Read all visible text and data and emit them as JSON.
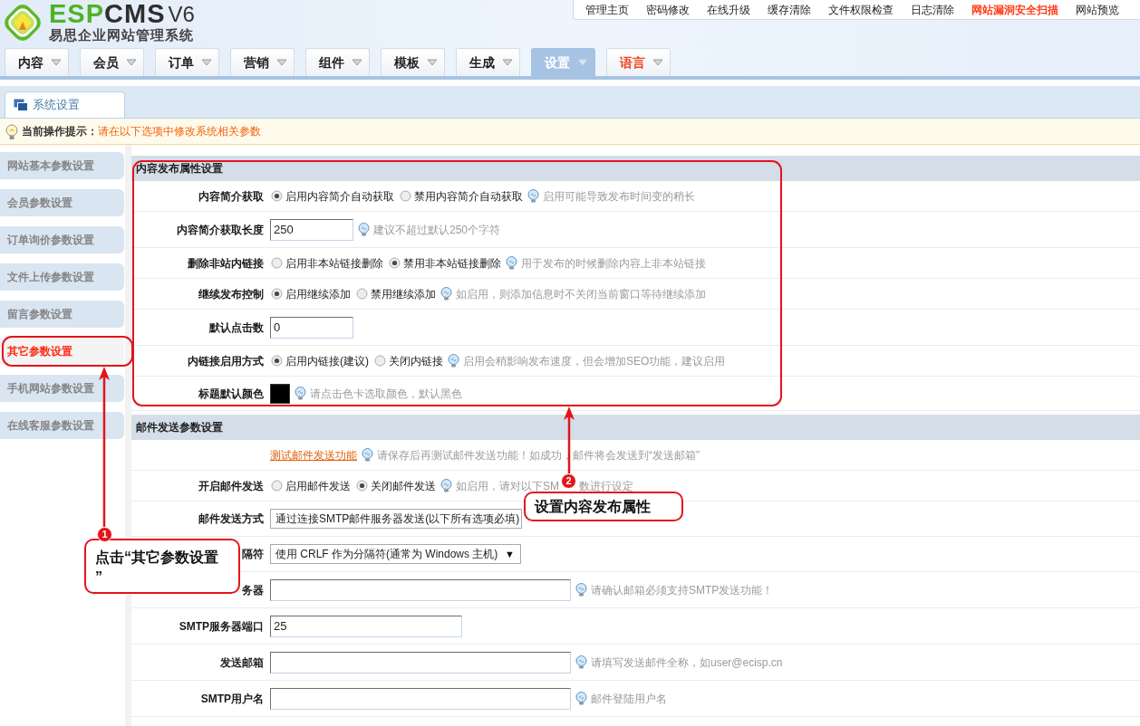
{
  "logo": {
    "wordmark": [
      {
        "text": "ESP",
        "color": "#4fb227"
      },
      {
        "text": "CMS",
        "color": "#2e2e2e"
      }
    ],
    "version": "V6",
    "tagline": "易思企业网站管理系统"
  },
  "top_links": [
    {
      "label": "管理主页",
      "highlight": false
    },
    {
      "label": "密码修改",
      "highlight": false
    },
    {
      "label": "在线升级",
      "highlight": false
    },
    {
      "label": "缓存清除",
      "highlight": false
    },
    {
      "label": "文件权限检查",
      "highlight": false
    },
    {
      "label": "日志清除",
      "highlight": false
    },
    {
      "label": "网站漏洞安全扫描",
      "highlight": true
    },
    {
      "label": "网站预览",
      "highlight": false
    }
  ],
  "main_tabs": [
    {
      "label": "内容",
      "selected": false,
      "highlight": false
    },
    {
      "label": "会员",
      "selected": false,
      "highlight": false
    },
    {
      "label": "订单",
      "selected": false,
      "highlight": false
    },
    {
      "label": "营销",
      "selected": false,
      "highlight": false
    },
    {
      "label": "组件",
      "selected": false,
      "highlight": false
    },
    {
      "label": "模板",
      "selected": false,
      "highlight": false
    },
    {
      "label": "生成",
      "selected": false,
      "highlight": false
    },
    {
      "label": "设置",
      "selected": true,
      "highlight": false
    },
    {
      "label": "语言",
      "selected": false,
      "highlight": true
    }
  ],
  "sub_tabs": [
    {
      "label": "系统设置",
      "selected": true
    }
  ],
  "notice": {
    "label": "当前操作提示：",
    "message": "请在以下选项中修改系统相关参数"
  },
  "sidebar": {
    "items": [
      {
        "label": "网站基本参数设置",
        "selected": false
      },
      {
        "label": "会员参数设置",
        "selected": false
      },
      {
        "label": "订单询价参数设置",
        "selected": false
      },
      {
        "label": "文件上传参数设置",
        "selected": false
      },
      {
        "label": "留言参数设置",
        "selected": false
      },
      {
        "label": "其它参数设置",
        "selected": true
      },
      {
        "label": "手机网站参数设置",
        "selected": false
      },
      {
        "label": "在线客服参数设置",
        "selected": false
      }
    ]
  },
  "sections": [
    {
      "title": "内容发布属性设置",
      "rows": [
        {
          "kind": "radio",
          "label": "内容简介获取",
          "options": [
            {
              "label": "启用内容简介自动获取",
              "selected": true
            },
            {
              "label": "禁用内容简介自动获取",
              "selected": false
            }
          ],
          "hint": "启用可能导致发布时间变的稍长"
        },
        {
          "kind": "short_input",
          "label": "内容简介获取长度",
          "value": "250",
          "hint": "建议不超过默认250个字符"
        },
        {
          "kind": "radio",
          "label": "删除非站内链接",
          "options": [
            {
              "label": "启用非本站链接删除",
              "selected": false
            },
            {
              "label": "禁用非本站链接删除",
              "selected": true
            }
          ],
          "hint": "用于发布的时候删除内容上非本站链接"
        },
        {
          "kind": "radio",
          "label": "继续发布控制",
          "options": [
            {
              "label": "启用继续添加",
              "selected": true
            },
            {
              "label": "禁用继续添加",
              "selected": false
            }
          ],
          "hint": "如启用，则添加信息时不关闭当前窗口等待继续添加"
        },
        {
          "kind": "short_input",
          "label": "默认点击数",
          "value": "0"
        },
        {
          "kind": "radio",
          "label": "内链接启用方式",
          "options": [
            {
              "label": "启用内链接(建议)",
              "selected": true
            },
            {
              "label": "关闭内链接",
              "selected": false
            }
          ],
          "hint": "启用会稍影响发布速度，但会增加SEO功能，建议启用"
        },
        {
          "kind": "color",
          "label": "标题默认颜色",
          "color": "#000000",
          "hint": "请点击色卡选取颜色，默认黑色"
        }
      ]
    },
    {
      "title": "邮件发送参数设置",
      "rows": [
        {
          "kind": "link",
          "link": "测试邮件发送功能",
          "hint": "请保存后再测试邮件发送功能！如成功，邮件将会发送到“发送邮箱”"
        },
        {
          "kind": "radio",
          "label": "开启邮件发送",
          "options": [
            {
              "label": "启用邮件发送",
              "selected": false
            },
            {
              "label": "关闭邮件发送",
              "selected": true
            }
          ],
          "hint": "如启用，请对以下SM",
          "hint_tail": "数进行设定"
        },
        {
          "kind": "select",
          "label": "邮件发送方式",
          "value": "通过连接SMTP邮件服务器发送(以下所有选项必填)"
        },
        {
          "kind": "select",
          "label": "隔符",
          "value": "使用 CRLF 作为分隔符(通常为 Windows 主机)",
          "arrow": "▼"
        },
        {
          "kind": "long_input",
          "label": "务器",
          "hint": "请确认邮箱必须支持SMTP发送功能！"
        },
        {
          "kind": "medium_input",
          "label": "SMTP服务器端口",
          "value": "25"
        },
        {
          "kind": "long_input",
          "label": "发送邮箱",
          "hint": "请填写发送邮件全称，如user@ecisp.cn"
        },
        {
          "kind": "long_input",
          "label": "SMTP用户名",
          "hint": "邮件登陆用户名"
        }
      ]
    }
  ],
  "annotations": [
    {
      "number": "1",
      "text": "点击“其它参数设置”"
    },
    {
      "number": "2",
      "text": "设置内容发布属性"
    }
  ]
}
